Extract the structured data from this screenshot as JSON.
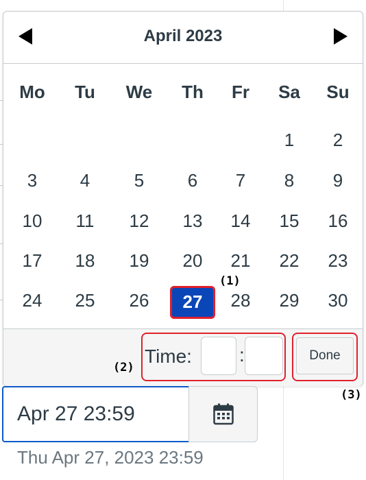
{
  "calendar": {
    "month_title": "April 2023",
    "prev_icon": "triangle-left-icon",
    "next_icon": "triangle-right-icon",
    "weekdays": [
      "Mo",
      "Tu",
      "We",
      "Th",
      "Fr",
      "Sa",
      "Su"
    ],
    "weeks": [
      [
        "",
        "",
        "",
        "",
        "",
        "1",
        "2"
      ],
      [
        "3",
        "4",
        "5",
        "6",
        "7",
        "8",
        "9"
      ],
      [
        "10",
        "11",
        "12",
        "13",
        "14",
        "15",
        "16"
      ],
      [
        "17",
        "18",
        "19",
        "20",
        "21",
        "22",
        "23"
      ],
      [
        "24",
        "25",
        "26",
        "27",
        "28",
        "29",
        "30"
      ]
    ],
    "selected_day": "27"
  },
  "time": {
    "label": "Time:",
    "colon": ":",
    "hour_value": "",
    "minute_value": ""
  },
  "done_button_label": "Done",
  "annotations": [
    "(1)",
    "(2)",
    "(3)"
  ],
  "date_input": {
    "value": "Apr 27 23:59"
  },
  "calendar_button_icon": "calendar-icon",
  "formatted_date": "Thu Apr 27, 2023 23:59",
  "colors": {
    "selected_bg": "#0b46b8",
    "annotation_red": "#e0202b",
    "focus_blue": "#0b59c9",
    "text": "#2d3b45"
  }
}
